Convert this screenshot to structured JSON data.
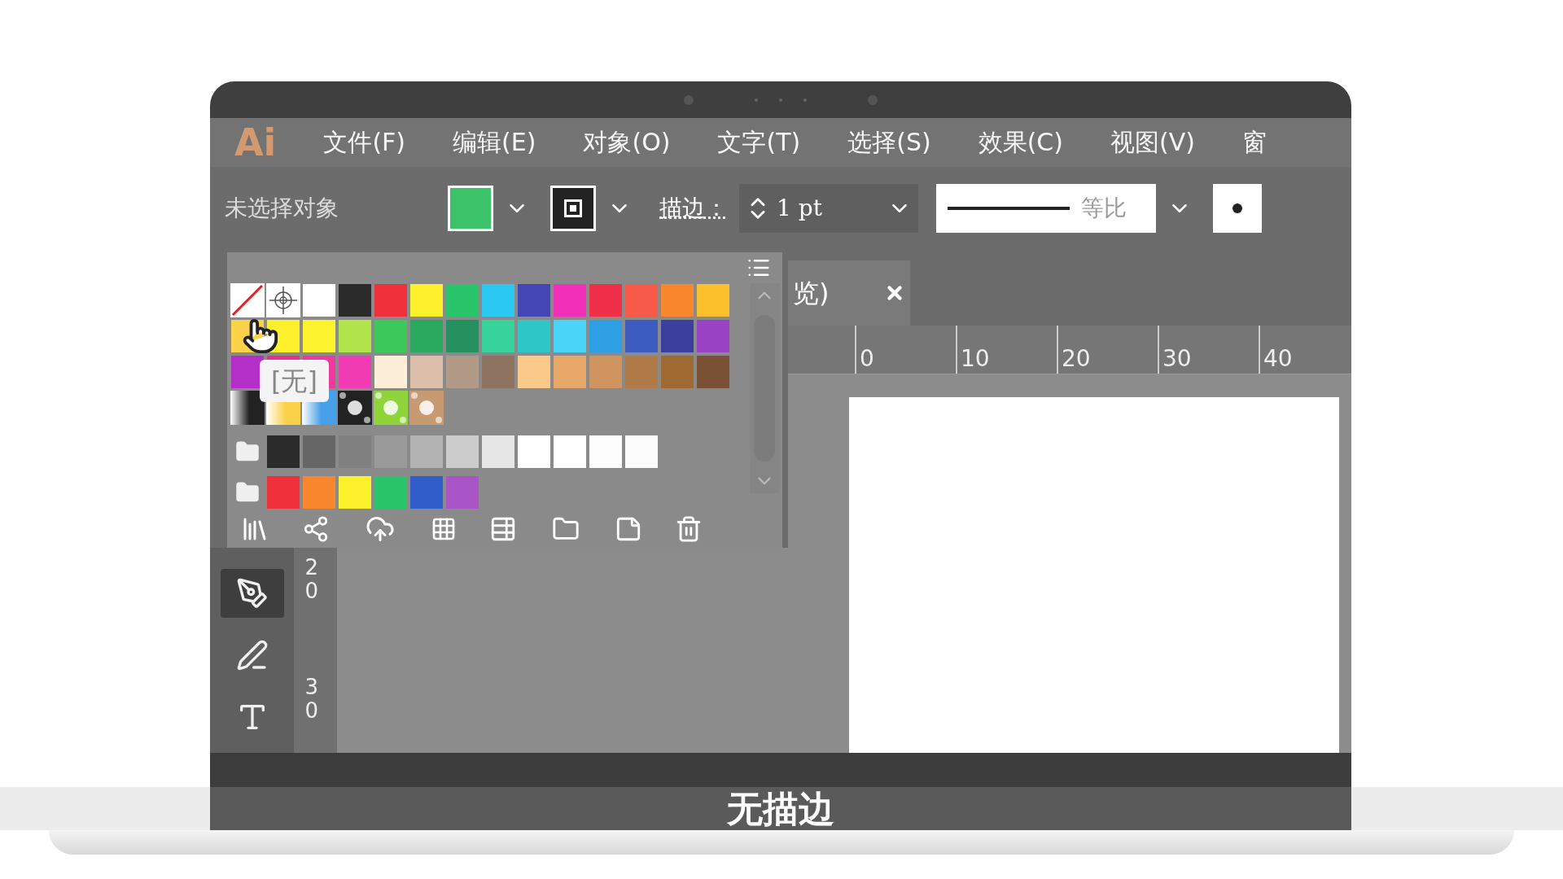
{
  "menu_bar": {
    "logo": "Ai",
    "items": [
      "文件(F)",
      "编辑(E)",
      "对象(O)",
      "文字(T)",
      "选择(S)",
      "效果(C)",
      "视图(V)",
      "窗"
    ]
  },
  "control_bar": {
    "selection_label": "未选择对象",
    "fill": {
      "color": "#3cc36a"
    },
    "stroke_label": "描边：",
    "stroke_weight": "1 pt",
    "profile_label": "等比"
  },
  "swatches_panel": {
    "tooltip": "[无]",
    "rows": [
      [
        {
          "kind": "none"
        },
        {
          "kind": "registration"
        },
        {
          "kind": "color",
          "color": "#ffffff"
        },
        {
          "kind": "color",
          "color": "#2b2b2b"
        },
        {
          "kind": "color",
          "color": "#f0303a"
        },
        {
          "kind": "color",
          "color": "#fdf12c"
        },
        {
          "kind": "color",
          "color": "#29c46a"
        },
        {
          "kind": "color",
          "color": "#2bc8f4"
        },
        {
          "kind": "color",
          "color": "#4346b4"
        },
        {
          "kind": "color",
          "color": "#f12fb8"
        },
        {
          "kind": "color",
          "color": "#ef3048"
        },
        {
          "kind": "color",
          "color": "#f75a48"
        },
        {
          "kind": "color",
          "color": "#f7862d"
        },
        {
          "kind": "color",
          "color": "#fcc02c"
        }
      ],
      [
        {
          "kind": "color",
          "color": "#fcd24a"
        },
        {
          "kind": "color",
          "color": "#fdf12c"
        },
        {
          "kind": "color",
          "color": "#fdf32e"
        },
        {
          "kind": "color",
          "color": "#b2e44c"
        },
        {
          "kind": "color",
          "color": "#3cc85a"
        },
        {
          "kind": "color",
          "color": "#2aaa5e"
        },
        {
          "kind": "color",
          "color": "#24915e"
        },
        {
          "kind": "color",
          "color": "#36d49a"
        },
        {
          "kind": "color",
          "color": "#2ec6c6"
        },
        {
          "kind": "color",
          "color": "#4ad4f7"
        },
        {
          "kind": "color",
          "color": "#2f9fe4"
        },
        {
          "kind": "color",
          "color": "#3c5cc0"
        },
        {
          "kind": "color",
          "color": "#3c3f9e"
        },
        {
          "kind": "color",
          "color": "#9a44c4"
        }
      ],
      [
        {
          "kind": "color",
          "color": "#b32fc7"
        },
        {
          "kind": "color",
          "color": "#e8308a"
        },
        {
          "kind": "color",
          "color": "#ee3a9e"
        },
        {
          "kind": "color",
          "color": "#f03bb3"
        },
        {
          "kind": "color",
          "color": "#fdeed8"
        },
        {
          "kind": "color",
          "color": "#dcbfaa"
        },
        {
          "kind": "color",
          "color": "#b09a86"
        },
        {
          "kind": "color",
          "color": "#8f7361"
        },
        {
          "kind": "color",
          "color": "#fbc98a"
        },
        {
          "kind": "color",
          "color": "#e8a86a"
        },
        {
          "kind": "color",
          "color": "#cf9460"
        },
        {
          "kind": "color",
          "color": "#b07a48"
        },
        {
          "kind": "color",
          "color": "#9e6a32"
        },
        {
          "kind": "color",
          "color": "#7a5134"
        }
      ],
      [
        {
          "kind": "gradient",
          "color": "#222222"
        },
        {
          "kind": "gradient",
          "color": "#fcd24a"
        },
        {
          "kind": "gradient",
          "color": "#4aa0e8"
        },
        {
          "kind": "pattern",
          "color": "#222222"
        },
        {
          "kind": "pattern",
          "color": "#8ed43a"
        },
        {
          "kind": "pattern",
          "color": "#c89a72"
        }
      ],
      [
        {
          "kind": "folder"
        },
        {
          "kind": "color",
          "color": "#2b2b2b"
        },
        {
          "kind": "color",
          "color": "#666666"
        },
        {
          "kind": "color",
          "color": "#808080"
        },
        {
          "kind": "color",
          "color": "#9a9a9a"
        },
        {
          "kind": "color",
          "color": "#b3b3b3"
        },
        {
          "kind": "color",
          "color": "#cccccc"
        },
        {
          "kind": "color",
          "color": "#e6e6e6"
        },
        {
          "kind": "color",
          "color": "#ffffff"
        },
        {
          "kind": "color",
          "color": "#fefefe"
        },
        {
          "kind": "color",
          "color": "#fdfdfd"
        },
        {
          "kind": "color",
          "color": "#fcfcfc"
        }
      ],
      [
        {
          "kind": "folder"
        },
        {
          "kind": "color",
          "color": "#f0303a"
        },
        {
          "kind": "color",
          "color": "#f7862d"
        },
        {
          "kind": "color",
          "color": "#fdf12c"
        },
        {
          "kind": "color",
          "color": "#29c46a"
        },
        {
          "kind": "color",
          "color": "#2f5ecb"
        },
        {
          "kind": "color",
          "color": "#a955c8"
        }
      ]
    ]
  },
  "document_tab": {
    "title": "览)"
  },
  "horizontal_ruler": [
    "0",
    "10",
    "20",
    "30",
    "40"
  ],
  "vertical_ruler": [
    "20",
    "30"
  ],
  "tools": [
    {
      "kind": "pen",
      "selected": true
    },
    {
      "kind": "curvature",
      "selected": false
    },
    {
      "kind": "type",
      "selected": false
    }
  ],
  "subtitle": "无描边"
}
